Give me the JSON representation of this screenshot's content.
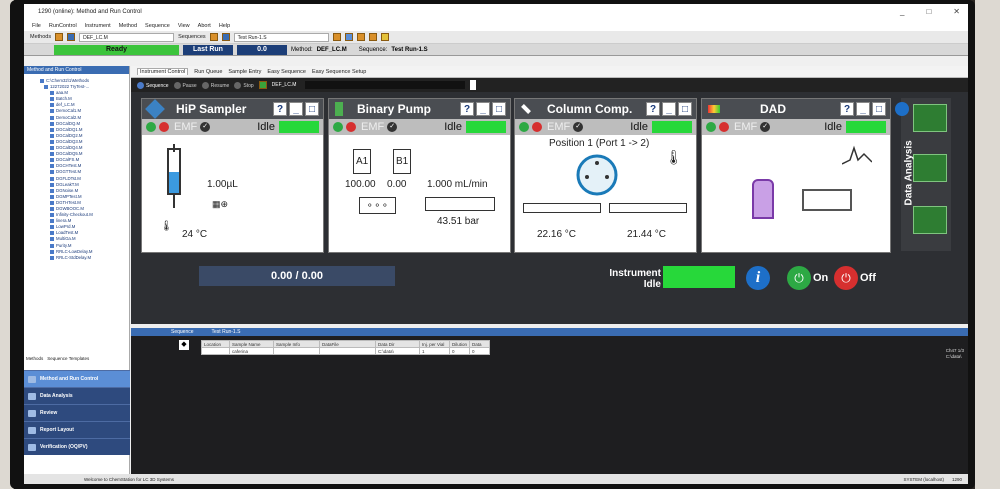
{
  "window": {
    "title": "1290 (online): Method and Run Control",
    "controls": [
      "_",
      "□",
      "✕"
    ]
  },
  "menu": [
    "File",
    "RunControl",
    "Instrument",
    "Method",
    "Sequence",
    "View",
    "Abort",
    "Help"
  ],
  "toolbar": {
    "methods_label": "Methods",
    "method_file": "DEF_LC.M",
    "sequences_label": "Sequences",
    "seq_file": "Test Run-1.S"
  },
  "status": {
    "ready": "Ready",
    "last_run_label": "Last Run",
    "last_run_value": "0.0",
    "method_label": "Method:",
    "method_value": "DEF_LC.M",
    "sequence_label": "Sequence:",
    "sequence_value": "Test Run-1.S"
  },
  "left_panel": {
    "header": "Method and Run Control",
    "tree_root": "C:\\Chem32\\1\\Methods",
    "tree_items": [
      "12272022 TryTest-...",
      "aaa.M",
      "Batch.M",
      "def_LC.M",
      "DemoCal1.M",
      "DemoCal2.M",
      "DGCalDQ.M",
      "DGCalDQ1.M",
      "DGCalDQ2.M",
      "DGCalDQ3.M",
      "DGCalDQ4.M",
      "DGCalDQ5.M",
      "DGCalFS.M",
      "DGCHTest.M",
      "DGGTTest.M",
      "DGFLDTst.M",
      "DGLeakT.M",
      "DGNoise.M",
      "DGMPTest.M",
      "DGTHTest.M",
      "DGWBOOC.M",
      "Infinity-Checkout.M",
      "linera.M",
      "LowPrd.M",
      "LoadTest.M",
      "MultiGa.M",
      "Purity.M",
      "RRLC-LowDelay.M",
      "RRLC-StdDelay.M"
    ],
    "bottom_tabs": [
      "Methods",
      "Sequence Templates"
    ]
  },
  "nav": [
    "Method and Run Control",
    "Data Analysis",
    "Review",
    "Report Layout",
    "Verification (OQ/PV)"
  ],
  "main_tabs": [
    "Instrument Control",
    "Run Queue",
    "Sample Entry",
    "Easy Sequence",
    "Easy Sequence Setup"
  ],
  "seqbar": {
    "items": [
      "Sequence",
      "Pause",
      "Resume",
      "Stop"
    ],
    "method": "DEF_LC.M"
  },
  "modules": [
    {
      "name": "HiP Sampler",
      "state": "Idle",
      "volume": "1.00µL",
      "temp": "24 °C"
    },
    {
      "name": "Binary Pump",
      "state": "Idle",
      "a_label": "A1",
      "b_label": "B1",
      "a_pct": "100.00",
      "b_pct": "0.00",
      "flow": "1.000 mL/min",
      "pressure": "43.51 bar"
    },
    {
      "name": "Column Comp.",
      "state": "Idle",
      "position": "Position 1 (Port 1 -> 2)",
      "t_left": "22.16 °C",
      "t_right": "21.44 °C"
    },
    {
      "name": "DAD",
      "state": "Idle"
    }
  ],
  "emf": "EMF",
  "progress": "0.00 / 0.00",
  "instrument_state_line1": "Instrument",
  "instrument_state_line2": "Idle",
  "on_label": "On",
  "off_label": "Off",
  "data_analysis_label": "Data Analysis",
  "sequence_pane": {
    "tabs": [
      "Sequence",
      "Test Run-1.S"
    ],
    "columns": [
      "Location",
      "Sample Name",
      "Sample Info",
      "DataFile",
      "Data Dir",
      "Inj. per Vial",
      "Dilution",
      "Data"
    ],
    "row": [
      "",
      "caferina",
      "",
      "",
      "C:\\data\\",
      "1",
      "0",
      "0"
    ],
    "side": [
      "Ch47 1/3",
      "C:\\data\\"
    ]
  },
  "taskbar": {
    "left": "Welcome to ChemStation for LC 3D Systems",
    "user": "SYSTEM (localhost)",
    "inst": "1290"
  },
  "colors": {
    "idle_green": "#27d83a",
    "dash_bg": "#2d2f33",
    "nav_active": "#5b8ed6"
  }
}
